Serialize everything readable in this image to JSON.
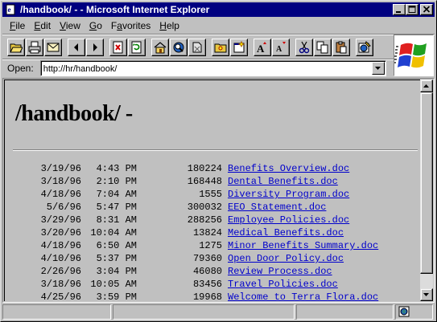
{
  "window": {
    "title": "/handbook/ - - Microsoft Internet Explorer"
  },
  "menu": [
    {
      "label": "File",
      "accel": "F",
      "rest": "ile"
    },
    {
      "label": "Edit",
      "accel": "E",
      "rest": "dit"
    },
    {
      "label": "View",
      "accel": "V",
      "rest": "iew"
    },
    {
      "label": "Go",
      "accel": "G",
      "rest": "o"
    },
    {
      "label": "Favorites",
      "accel": "a",
      "pre": "F",
      "rest": "vorites"
    },
    {
      "label": "Help",
      "accel": "H",
      "rest": "elp"
    }
  ],
  "address": {
    "label": "Open:",
    "value": "http://hr/handbook/"
  },
  "page": {
    "heading": "/handbook/ -"
  },
  "listing": [
    {
      "date": "3/19/96",
      "time": "4:43 PM",
      "size": "180224",
      "name": "Benefits Overview.doc"
    },
    {
      "date": "3/18/96",
      "time": "2:10 PM",
      "size": "168448",
      "name": "Dental Benefits.doc"
    },
    {
      "date": "4/18/96",
      "time": "7:04 AM",
      "size": "1555",
      "name": "Diversity Program.doc"
    },
    {
      "date": "5/6/96",
      "time": "5:47 PM",
      "size": "300032",
      "name": "EEO Statement.doc"
    },
    {
      "date": "3/29/96",
      "time": "8:31 AM",
      "size": "288256",
      "name": "Employee Policies.doc"
    },
    {
      "date": "3/20/96",
      "time": "10:04 AM",
      "size": "13824",
      "name": "Medical Benefits.doc"
    },
    {
      "date": "4/18/96",
      "time": "6:50 AM",
      "size": "1275",
      "name": "Minor Benefits Summary.doc"
    },
    {
      "date": "4/10/96",
      "time": "5:37 PM",
      "size": "79360",
      "name": "Open Door Policy.doc"
    },
    {
      "date": "2/26/96",
      "time": "3:04 PM",
      "size": "46080",
      "name": "Review Process.doc"
    },
    {
      "date": "3/18/96",
      "time": "10:05 AM",
      "size": "83456",
      "name": "Travel Policies.doc"
    },
    {
      "date": "4/25/96",
      "time": "3:59 PM",
      "size": "19968",
      "name": "Welcome to Terra Flora.doc"
    }
  ],
  "colors": {
    "title_bar": "#000080",
    "link": "#0000cc",
    "chrome": "#c0c0c0"
  },
  "toolbar_icons": [
    "open-icon",
    "print-icon",
    "mail-icon",
    "back-icon",
    "forward-icon",
    "stop-icon",
    "refresh-icon",
    "home-icon",
    "search-icon",
    "favorites-icon",
    "open-folder-icon",
    "new-window-icon",
    "font-larger-icon",
    "font-smaller-icon",
    "cut-icon",
    "copy-icon",
    "paste-icon",
    "edit-page-icon"
  ]
}
